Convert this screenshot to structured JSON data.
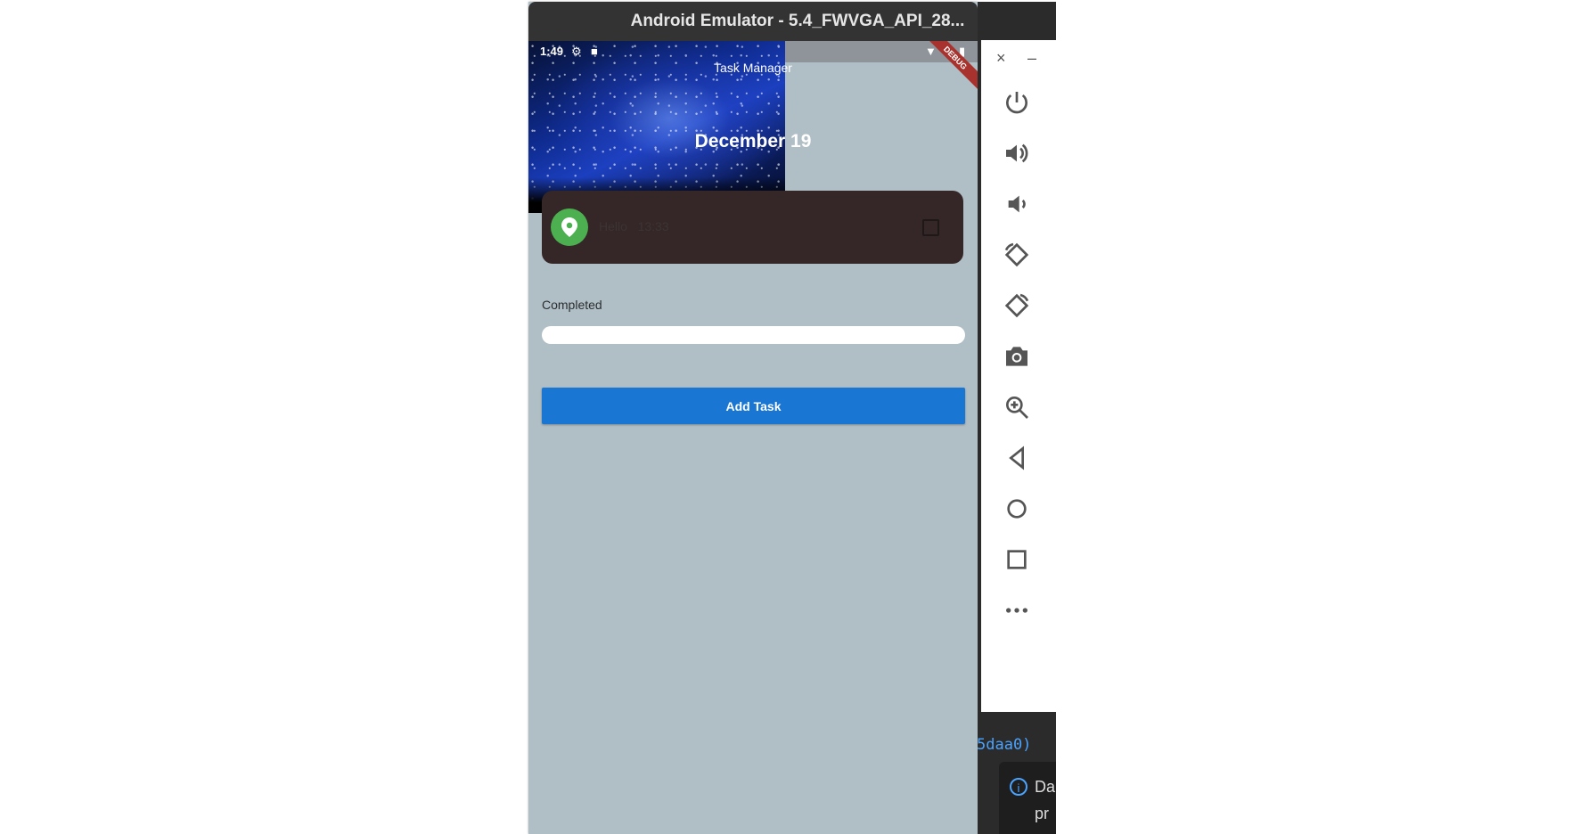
{
  "window": {
    "title": "Android Emulator - 5.4_FWVGA_API_28..."
  },
  "status_bar": {
    "time": "1:49",
    "settings_icon": "gear-icon",
    "sd_icon": "sd-card-icon",
    "wifi_icon": "wifi-icon",
    "battery_icon": "battery-icon"
  },
  "app": {
    "title": "Task Manager",
    "date_heading": "December 19",
    "debug_banner": "DEBUG",
    "task": {
      "name": "Hello",
      "time": "13:33",
      "icon": "location-pin-icon",
      "icon_color": "#4caf50",
      "checked": false
    },
    "completed_label": "Completed",
    "progress": 0,
    "add_button_label": "Add Task",
    "accent_color": "#1976d2",
    "card_color": "#352727",
    "background_color": "#b0bec5"
  },
  "emulator_controls": {
    "close": "×",
    "minimize": "–",
    "tools": [
      "power-icon",
      "volume-up-icon",
      "volume-down-icon",
      "rotate-left-icon",
      "rotate-right-icon",
      "camera-icon",
      "zoom-in-icon",
      "back-icon",
      "home-icon",
      "overview-icon",
      "more-icon"
    ]
  },
  "ide": {
    "code_fragment": "5daa0)",
    "notice_line1": "Da",
    "notice_line2": "pr"
  }
}
